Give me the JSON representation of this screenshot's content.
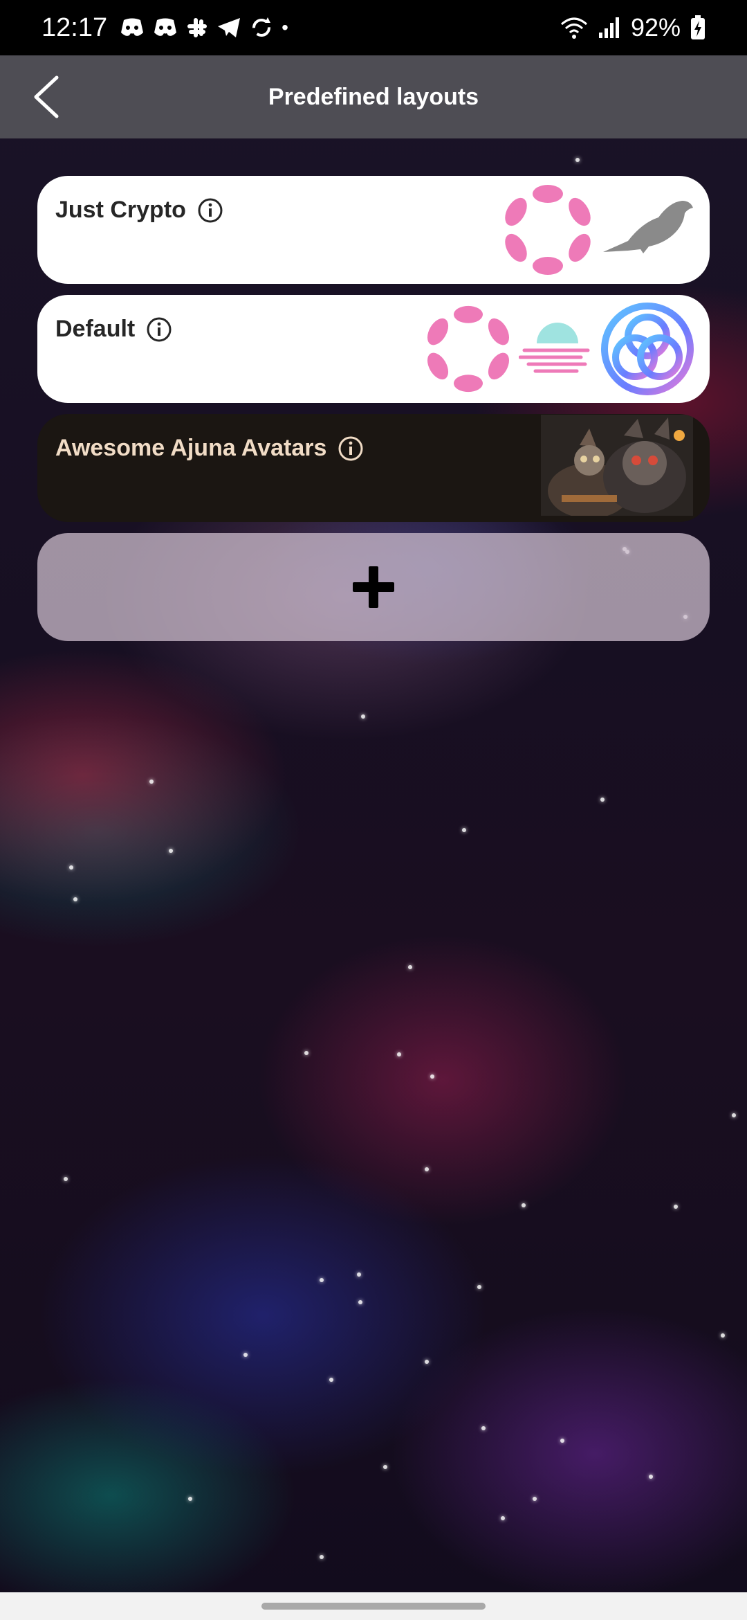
{
  "status_bar": {
    "time": "12:17",
    "battery": "92%",
    "notification_icons": [
      "discord-icon",
      "discord-icon",
      "slack-icon",
      "telegram-icon",
      "sync-icon",
      "dot-icon"
    ]
  },
  "header": {
    "title": "Predefined layouts"
  },
  "layouts": [
    {
      "name": "Just Crypto",
      "style": "light",
      "images": [
        "polkadot-logo",
        "crow-icon"
      ]
    },
    {
      "name": "Default",
      "style": "light",
      "images": [
        "polkadot-logo",
        "moonbeam-logo",
        "knot-logo"
      ]
    },
    {
      "name": "Awesome Ajuna Avatars",
      "style": "dark",
      "images": [
        "avatar-artwork"
      ]
    }
  ],
  "add_card": {
    "icon": "plus-icon"
  },
  "colors": {
    "card_light": "#ffffff",
    "card_dark": "#1b1612",
    "card_dark_text": "#f1dcc6",
    "polkadot_pink": "#e6007a",
    "header_bg": "#5a5a5f"
  }
}
